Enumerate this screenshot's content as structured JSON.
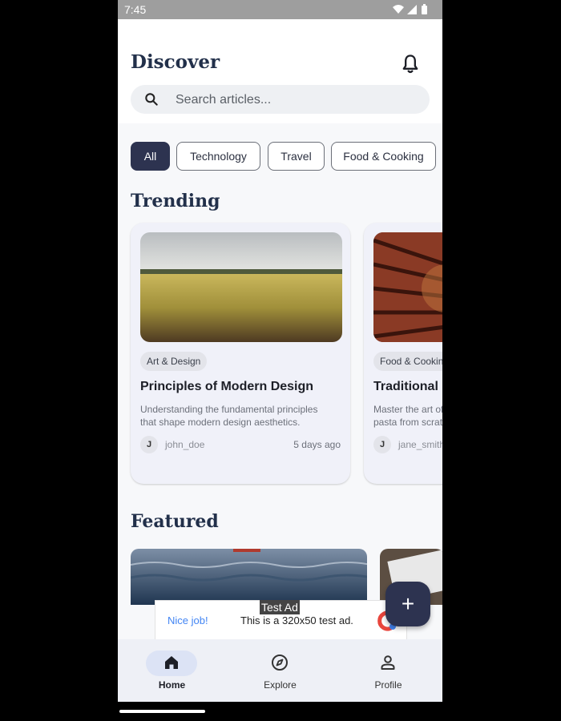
{
  "status_bar": {
    "time": "7:45"
  },
  "header": {
    "title": "Discover",
    "notification_icon": "bell-icon"
  },
  "search": {
    "placeholder": "Search articles...",
    "icon": "search-icon"
  },
  "categories": [
    {
      "label": "All",
      "active": true
    },
    {
      "label": "Technology",
      "active": false
    },
    {
      "label": "Travel",
      "active": false
    },
    {
      "label": "Food & Cooking",
      "active": false
    }
  ],
  "trending": {
    "title": "Trending",
    "cards": [
      {
        "tag": "Art & Design",
        "title": "Principles of Modern Design",
        "description": "Understanding the fundamental principles that shape modern design aesthetics.",
        "avatar_initial": "J",
        "author": "john_doe",
        "time": "5 days ago"
      },
      {
        "tag": "Food & Cooking",
        "title": "Traditional Italian Pasta",
        "description": "Master the art of making authentic Italian pasta from scratch.",
        "avatar_initial": "J",
        "author": "jane_smith",
        "time": ""
      }
    ]
  },
  "featured": {
    "title": "Featured"
  },
  "ad": {
    "label": "Test Ad",
    "cta": "Nice job!",
    "message": "This is a 320x50 test ad."
  },
  "fab": {
    "label": "+",
    "icon": "plus-icon"
  },
  "bottom_nav": [
    {
      "label": "Home",
      "icon": "home-icon",
      "active": true
    },
    {
      "label": "Explore",
      "icon": "compass-icon",
      "active": false
    },
    {
      "label": "Profile",
      "icon": "person-icon",
      "active": false
    }
  ],
  "colors": {
    "accent": "#2d3350",
    "title": "#22304a",
    "ad_link": "#4285f4",
    "nav_active_pill": "#dce3f5"
  }
}
